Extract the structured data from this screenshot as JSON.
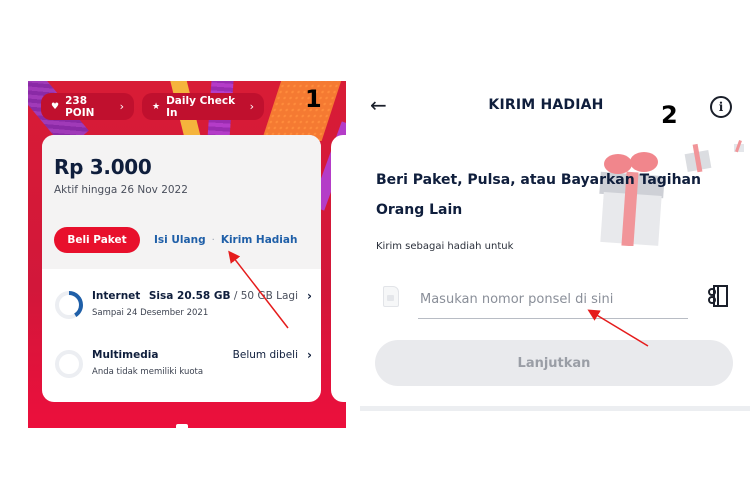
{
  "panel1": {
    "number": "1",
    "chips": {
      "poin": {
        "icon": "heart-icon",
        "label": "238 POIN"
      },
      "checkin": {
        "icon": "star-icon",
        "label": "Daily Check In"
      }
    },
    "balance": "Rp 3.000",
    "active_until": "Aktif hingga 26 Nov 2022",
    "actions": {
      "buy": "Beli Paket",
      "topup": "Isi Ulang",
      "separator": "·",
      "gift": "Kirim Hadiah"
    },
    "quota_rows": [
      {
        "title": "Internet",
        "subtitle": "Sampai 24 Desember 2021",
        "remaining_label": "Sisa 20.58 GB",
        "total_label": "/ 50 GB Lagi",
        "remaining_fraction": 0.41
      },
      {
        "title": "Multimedia",
        "subtitle": "Anda tidak memiliki kuota",
        "status_label": "Belum dibeli",
        "remaining_fraction": 0
      }
    ]
  },
  "panel2": {
    "number": "2",
    "title": "KIRIM HADIAH",
    "headline": "Beri Paket, Pulsa, atau Bayarkan Tagihan Orang Lain",
    "sublabel": "Kirim sebagai hadiah untuk",
    "phone_input": {
      "value": "",
      "placeholder": "Masukan nomor ponsel di sini"
    },
    "continue_button": "Lanjutkan"
  },
  "colors": {
    "brand_red": "#e8102c",
    "link_blue": "#1f5fa8",
    "navy_text": "#0f1e3c",
    "progress_blue": "#1f5fa8",
    "annotation_red": "#e51c1c"
  }
}
